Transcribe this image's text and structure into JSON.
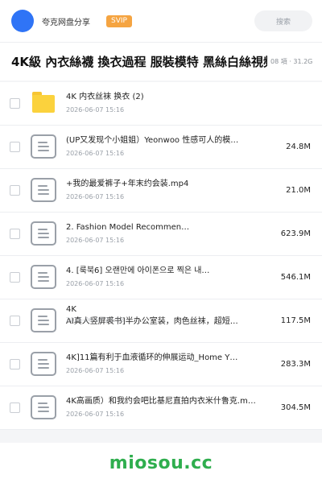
{
  "header": {
    "brand": "夸克网盘分享",
    "badge": "SVIP",
    "search_label": "搜索"
  },
  "folder": {
    "title": "4K級 內衣絲襪 換衣過程 服裝模特 黑絲白絲視頻",
    "meta": "08 項 · 31.2G"
  },
  "files": [
    {
      "name": "4K 内衣丝袜 换衣 (2)",
      "date": "2026-06-07 15:16",
      "size": "",
      "type": "folder"
    },
    {
      "name": "(UP又发现个小姐姐）Yeonwoo 性感可人的模…",
      "date": "2026-06-07 15:16",
      "size": "24.8M",
      "type": "doc"
    },
    {
      "name": "+我的最爱裤子+年末约会装.mp4",
      "date": "2026-06-07 15:16",
      "size": "21.0M",
      "type": "doc"
    },
    {
      "name": "2. Fashion Model Recommen…",
      "date": "2026-06-07 15:16",
      "size": "623.9M",
      "type": "doc"
    },
    {
      "name": "4. [룩북6] 오랜만에 아이폰으로 찍은 내…",
      "date": "2026-06-07 15:16",
      "size": "546.1M",
      "type": "doc"
    },
    {
      "name": "4K",
      "name2": "AI真人竖屏裘书]半办公室装，肉色丝袜，超短…",
      "date": "2026-06-07 15:16",
      "size": "117.5M",
      "type": "doc"
    },
    {
      "name": "4K]11篇有利于血液循环的伸展运动_Home Y…",
      "date": "2026-06-07 15:16",
      "size": "283.3M",
      "type": "doc"
    },
    {
      "name": "4K高画质）和我约会吧比基尼直拍内衣米什鲁克.m…",
      "date": "2026-06-07 15:16",
      "size": "304.5M",
      "type": "doc"
    }
  ],
  "watermark": "miosou.cc",
  "colors": {
    "accent": "#2f74f6",
    "badge": "#f5a441",
    "folder": "#fbd23d",
    "watermark": "#2fae4e"
  },
  "icons": {
    "folder": "folder-icon",
    "file": "document-icon",
    "logo": "brand-logo"
  }
}
